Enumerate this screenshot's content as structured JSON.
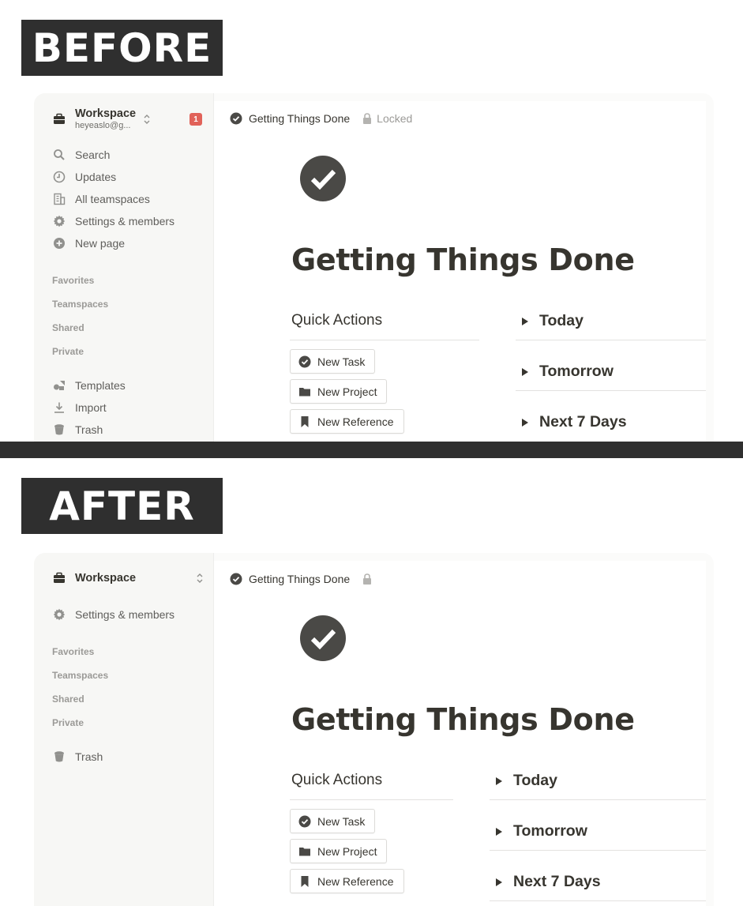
{
  "before": {
    "banner": "BEFORE",
    "workspace": {
      "name": "Workspace",
      "email": "heyeaslo@g...",
      "badge": "1"
    },
    "nav": [
      {
        "label": "Search",
        "icon": "search-icon"
      },
      {
        "label": "Updates",
        "icon": "clock-icon"
      },
      {
        "label": "All teamspaces",
        "icon": "building-icon"
      },
      {
        "label": "Settings & members",
        "icon": "gear-icon"
      },
      {
        "label": "New page",
        "icon": "plus-circle-icon"
      }
    ],
    "sections": [
      "Favorites",
      "Teamspaces",
      "Shared",
      "Private"
    ],
    "bottom_nav": [
      {
        "label": "Templates",
        "icon": "shapes-icon"
      },
      {
        "label": "Import",
        "icon": "download-icon"
      },
      {
        "label": "Trash",
        "icon": "trash-icon"
      }
    ],
    "breadcrumb": {
      "title": "Getting Things Done",
      "lock_label": "Locked"
    },
    "page_title": "Getting Things Done",
    "quick_actions": {
      "heading": "Quick Actions",
      "buttons": [
        {
          "label": "New Task",
          "icon": "check-circle-icon"
        },
        {
          "label": "New Project",
          "icon": "folder-icon"
        },
        {
          "label": "New Reference",
          "icon": "bookmark-icon"
        }
      ]
    },
    "toggles": [
      "Today",
      "Tomorrow",
      "Next 7 Days"
    ]
  },
  "after": {
    "banner": "AFTER",
    "workspace": {
      "name": "Workspace"
    },
    "nav": [
      {
        "label": "Settings & members",
        "icon": "gear-icon"
      }
    ],
    "sections": [
      "Favorites",
      "Teamspaces",
      "Shared",
      "Private"
    ],
    "bottom_nav": [
      {
        "label": "Trash",
        "icon": "trash-icon"
      }
    ],
    "breadcrumb": {
      "title": "Getting Things Done"
    },
    "page_title": "Getting Things Done",
    "quick_actions": {
      "heading": "Quick Actions",
      "buttons": [
        {
          "label": "New Task",
          "icon": "check-circle-icon"
        },
        {
          "label": "New Project",
          "icon": "folder-icon"
        },
        {
          "label": "New Reference",
          "icon": "bookmark-icon"
        }
      ]
    },
    "toggles": [
      "Today",
      "Tomorrow",
      "Next 7 Days"
    ]
  },
  "colors": {
    "banner_bg": "#2f2f2f",
    "sidebar_bg": "#f7f7f5",
    "text": "#37352f",
    "muted": "#9b9a97",
    "badge": "#e16259",
    "icon_dark": "#4a4946"
  }
}
